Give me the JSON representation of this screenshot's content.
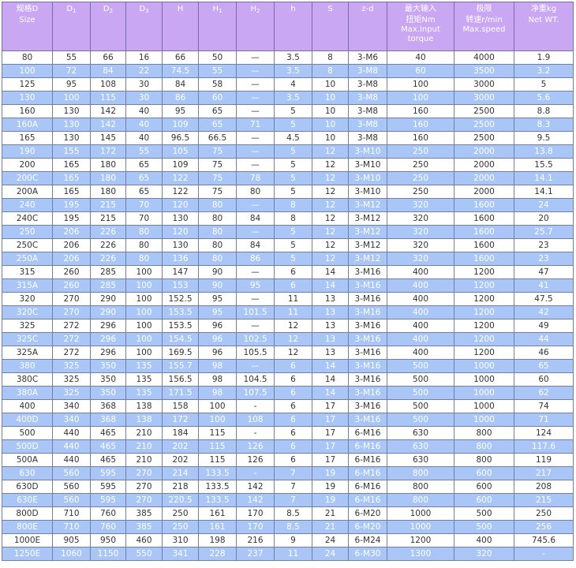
{
  "headers": [
    {
      "main": "规格D",
      "sub": "",
      "line2": "Size",
      "line3": "",
      "line4": ""
    },
    {
      "main": "D",
      "sub": "1",
      "line2": "",
      "line3": "",
      "line4": ""
    },
    {
      "main": "D",
      "sub": "2",
      "line2": "",
      "line3": "",
      "line4": ""
    },
    {
      "main": "D",
      "sub": "3",
      "line2": "",
      "line3": "",
      "line4": ""
    },
    {
      "main": "H",
      "sub": "",
      "line2": "",
      "line3": "",
      "line4": ""
    },
    {
      "main": "H",
      "sub": "1",
      "line2": "",
      "line3": "",
      "line4": ""
    },
    {
      "main": "H",
      "sub": "2",
      "line2": "",
      "line3": "",
      "line4": ""
    },
    {
      "main": "h",
      "sub": "",
      "line2": "",
      "line3": "",
      "line4": ""
    },
    {
      "main": "S",
      "sub": "",
      "line2": "",
      "line3": "",
      "line4": ""
    },
    {
      "main": "z-d",
      "sub": "",
      "line2": "",
      "line3": "",
      "line4": ""
    },
    {
      "main": "最大输入",
      "sub": "",
      "line2": "扭矩Nm",
      "line3": "Max.Input",
      "line4": "torque"
    },
    {
      "main": "极限",
      "sub": "",
      "line2": "转速r/min",
      "line3": "Max.speed",
      "line4": ""
    },
    {
      "main": "净重kg",
      "sub": "",
      "line2": "Net WT.",
      "line3": "",
      "line4": ""
    }
  ],
  "rows": [
    [
      "80",
      "55",
      "66",
      "16",
      "66",
      "50",
      "—",
      "3.5",
      "8",
      "3-M6",
      "40",
      "4000",
      "1.9"
    ],
    [
      "100",
      "72",
      "84",
      "22",
      "74.5",
      "55",
      "—",
      "3.5",
      "8",
      "3-M8",
      "60",
      "3500",
      "3.2"
    ],
    [
      "125",
      "95",
      "108",
      "30",
      "84",
      "58",
      "—",
      "4",
      "10",
      "3-M8",
      "100",
      "3000",
      "5"
    ],
    [
      "130",
      "100",
      "115",
      "30",
      "86",
      "60",
      "—",
      "3.5",
      "10",
      "3-M8",
      "100",
      "3000",
      "5.6"
    ],
    [
      "160",
      "130",
      "142",
      "40",
      "95",
      "65",
      "—",
      "5",
      "10",
      "3-M8",
      "160",
      "2500",
      "8.8"
    ],
    [
      "160A",
      "130",
      "142",
      "40",
      "109",
      "65",
      "71",
      "5",
      "10",
      "3-M8",
      "160",
      "2500",
      "8.3"
    ],
    [
      "165",
      "130",
      "145",
      "40",
      "96.5",
      "66.5",
      "—",
      "4.5",
      "10",
      "3-M8",
      "160",
      "2500",
      "9.5"
    ],
    [
      "190",
      "155",
      "172",
      "55",
      "105",
      "75",
      "—",
      "5",
      "12",
      "3-M10",
      "250",
      "2000",
      "13.8"
    ],
    [
      "200",
      "165",
      "180",
      "65",
      "109",
      "75",
      "—",
      "5",
      "12",
      "3-M10",
      "250",
      "2000",
      "15.5"
    ],
    [
      "200C",
      "165",
      "180",
      "65",
      "122",
      "75",
      "78",
      "5",
      "12",
      "3-M10",
      "250",
      "2000",
      "14.1"
    ],
    [
      "200A",
      "165",
      "180",
      "65",
      "122",
      "75",
      "80",
      "5",
      "12",
      "3-M10",
      "250",
      "2000",
      "14.1"
    ],
    [
      "240",
      "195",
      "215",
      "70",
      "120",
      "80",
      "—",
      "8",
      "12",
      "3-M12",
      "320",
      "1600",
      "24"
    ],
    [
      "240C",
      "195",
      "215",
      "70",
      "130",
      "80",
      "84",
      "8",
      "12",
      "3-M12",
      "320",
      "1600",
      "20"
    ],
    [
      "250",
      "206",
      "226",
      "80",
      "120",
      "80",
      "—",
      "5",
      "12",
      "3-M12",
      "320",
      "1600",
      "25.7"
    ],
    [
      "250C",
      "206",
      "226",
      "80",
      "130",
      "80",
      "84",
      "5",
      "12",
      "3-M12",
      "320",
      "1600",
      "23"
    ],
    [
      "250A",
      "206",
      "226",
      "80",
      "136",
      "80",
      "86",
      "5",
      "12",
      "3-M12",
      "320",
      "1600",
      "23"
    ],
    [
      "315",
      "260",
      "285",
      "100",
      "147",
      "90",
      "—",
      "6",
      "14",
      "3-M16",
      "400",
      "1200",
      "47"
    ],
    [
      "315A",
      "260",
      "285",
      "100",
      "153",
      "90",
      "95",
      "6",
      "14",
      "3-M16",
      "400",
      "1200",
      "41"
    ],
    [
      "320",
      "270",
      "290",
      "100",
      "152.5",
      "95",
      "—",
      "11",
      "13",
      "3-M16",
      "400",
      "1200",
      "47.5"
    ],
    [
      "320C",
      "270",
      "290",
      "100",
      "153.5",
      "95",
      "101.5",
      "11",
      "13",
      "3-M16",
      "400",
      "1200",
      "42"
    ],
    [
      "325",
      "272",
      "296",
      "100",
      "153.5",
      "96",
      "—",
      "12",
      "13",
      "3-M16",
      "400",
      "1200",
      "49"
    ],
    [
      "325C",
      "272",
      "296",
      "100",
      "154.5",
      "96",
      "102.5",
      "12",
      "13",
      "3-M16",
      "400",
      "1200",
      "44"
    ],
    [
      "325A",
      "272",
      "296",
      "100",
      "169.5",
      "96",
      "105.5",
      "12",
      "13",
      "3-M16",
      "400",
      "1200",
      "46"
    ],
    [
      "380",
      "325",
      "350",
      "135",
      "155.7",
      "98",
      "—",
      "6",
      "14",
      "3-M16",
      "500",
      "1000",
      "65"
    ],
    [
      "380C",
      "325",
      "350",
      "135",
      "156.5",
      "98",
      "104.5",
      "6",
      "14",
      "3-M16",
      "500",
      "1000",
      "60"
    ],
    [
      "380A",
      "325",
      "350",
      "135",
      "171.5",
      "98",
      "107.5",
      "6",
      "14",
      "3-M16",
      "500",
      "1000",
      "62"
    ],
    [
      "400",
      "340",
      "368",
      "138",
      "158",
      "100",
      "-",
      "6",
      "17",
      "3-M16",
      "500",
      "1000",
      "74"
    ],
    [
      "400D",
      "340",
      "368",
      "138",
      "172",
      "100",
      "108",
      "6",
      "17",
      "3-M16",
      "500",
      "1000",
      "71"
    ],
    [
      "500",
      "440",
      "465",
      "210",
      "184",
      "115",
      "-",
      "6",
      "17",
      "6-M16",
      "630",
      "800",
      "124"
    ],
    [
      "500D",
      "440",
      "465",
      "210",
      "202",
      "115",
      "126",
      "6",
      "17",
      "6-M16",
      "630",
      "800",
      "117.6"
    ],
    [
      "500A",
      "440",
      "465",
      "210",
      "202",
      "115",
      "126",
      "6",
      "17",
      "6-M16",
      "630",
      "800",
      "119"
    ],
    [
      "630",
      "560",
      "595",
      "270",
      "214",
      "133.5",
      "-",
      "7",
      "19",
      "6-M16",
      "800",
      "600",
      "217"
    ],
    [
      "630D",
      "560",
      "595",
      "270",
      "218",
      "133.5",
      "142",
      "7",
      "19",
      "6-M16",
      "800",
      "600",
      "208"
    ],
    [
      "630E",
      "560",
      "595",
      "270",
      "220.5",
      "133.5",
      "142",
      "7",
      "19",
      "6-M16",
      "800",
      "600",
      "215"
    ],
    [
      "800D",
      "710",
      "760",
      "385",
      "250",
      "161",
      "170",
      "8.5",
      "21",
      "6-M20",
      "1000",
      "500",
      "250"
    ],
    [
      "800E",
      "710",
      "760",
      "385",
      "250",
      "161",
      "170",
      "8.5",
      "21",
      "6-M20",
      "1000",
      "500",
      "256"
    ],
    [
      "1000E",
      "905",
      "950",
      "460",
      "310",
      "198",
      "216",
      "9",
      "24",
      "6-M24",
      "1200",
      "400",
      "745.6"
    ],
    [
      "1250E",
      "1060",
      "1150",
      "550",
      "341",
      "228",
      "237",
      "11",
      "24",
      "6-M30",
      "1300",
      "320",
      "-"
    ]
  ],
  "row_styles": [
    "w",
    "b",
    "w",
    "b",
    "w",
    "b",
    "w",
    "b",
    "w",
    "b",
    "w",
    "b",
    "w",
    "b",
    "w",
    "b",
    "w",
    "b",
    "w",
    "b",
    "w",
    "b",
    "w",
    "b",
    "w",
    "b",
    "w",
    "b",
    "w",
    "b",
    "w",
    "b",
    "w",
    "b",
    "w",
    "b",
    "w",
    "b"
  ]
}
